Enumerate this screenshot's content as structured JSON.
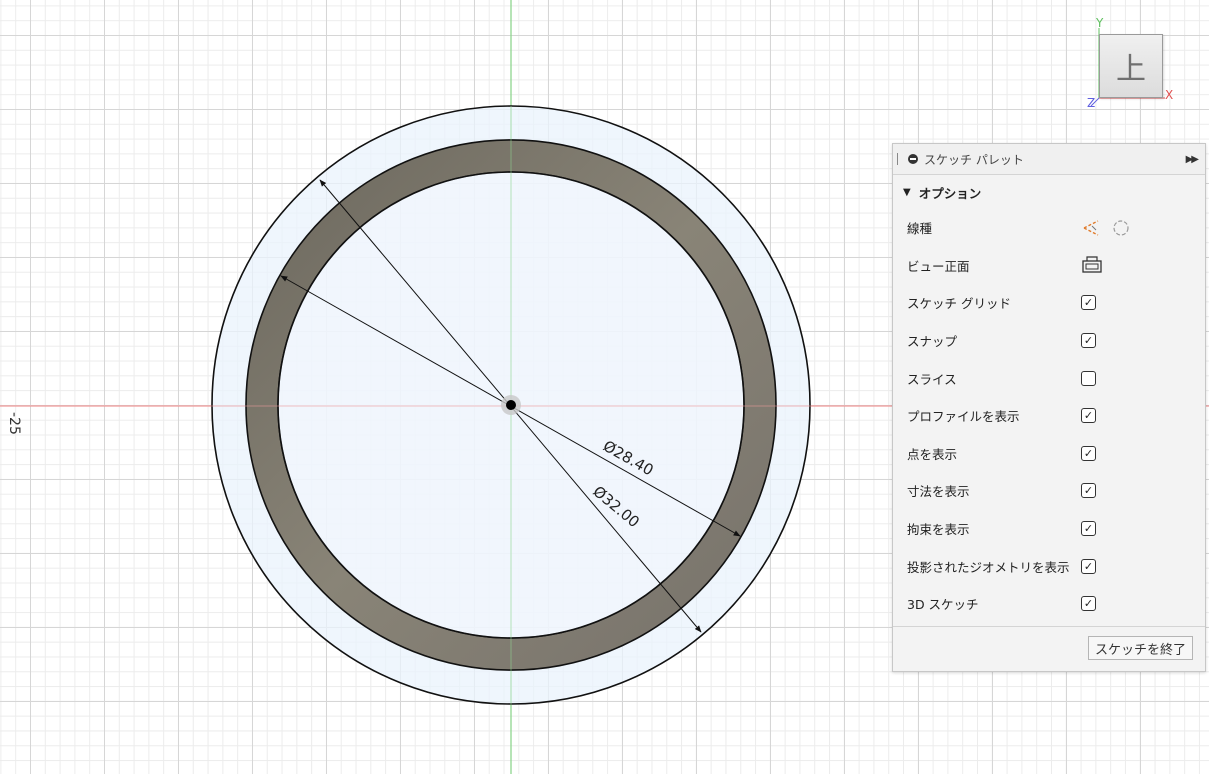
{
  "canvas": {
    "axis_tick_label": "-25",
    "dimensions": [
      {
        "label": "Ø28.40",
        "value": 28.4
      },
      {
        "label": "Ø32.00",
        "value": 32.0
      }
    ],
    "colors": {
      "x_axis": "#f19a9a",
      "y_axis": "#8fd68f",
      "ring_fill": "#7c776c",
      "outer_fill": "#eaf3fc",
      "inner_fill": "#f2f7fd"
    }
  },
  "view_cube": {
    "face_label": "上",
    "axis_x": "X",
    "axis_y": "Y",
    "axis_z": "Z",
    "colors": {
      "x": "#e05050",
      "y": "#60c060",
      "z": "#6060e0"
    }
  },
  "palette": {
    "title": "スケッチ パレット",
    "collapse_icon": "minus-circle-icon",
    "expand_icon": "double-chevron-right-icon",
    "section_title": "オプション",
    "options": [
      {
        "label": "線種",
        "control": "linetype-icons"
      },
      {
        "label": "ビュー正面",
        "control": "look-at-icon"
      },
      {
        "label": "スケッチ グリッド",
        "control": "checkbox",
        "checked": true
      },
      {
        "label": "スナップ",
        "control": "checkbox",
        "checked": true
      },
      {
        "label": "スライス",
        "control": "checkbox",
        "checked": false
      },
      {
        "label": "プロファイルを表示",
        "control": "checkbox",
        "checked": true
      },
      {
        "label": "点を表示",
        "control": "checkbox",
        "checked": true
      },
      {
        "label": "寸法を表示",
        "control": "checkbox",
        "checked": true
      },
      {
        "label": "拘束を表示",
        "control": "checkbox",
        "checked": true
      },
      {
        "label": "投影されたジオメトリを表示",
        "control": "checkbox",
        "checked": true
      },
      {
        "label": "3D スケッチ",
        "control": "checkbox",
        "checked": true
      }
    ],
    "finish_label": "スケッチを終了"
  }
}
